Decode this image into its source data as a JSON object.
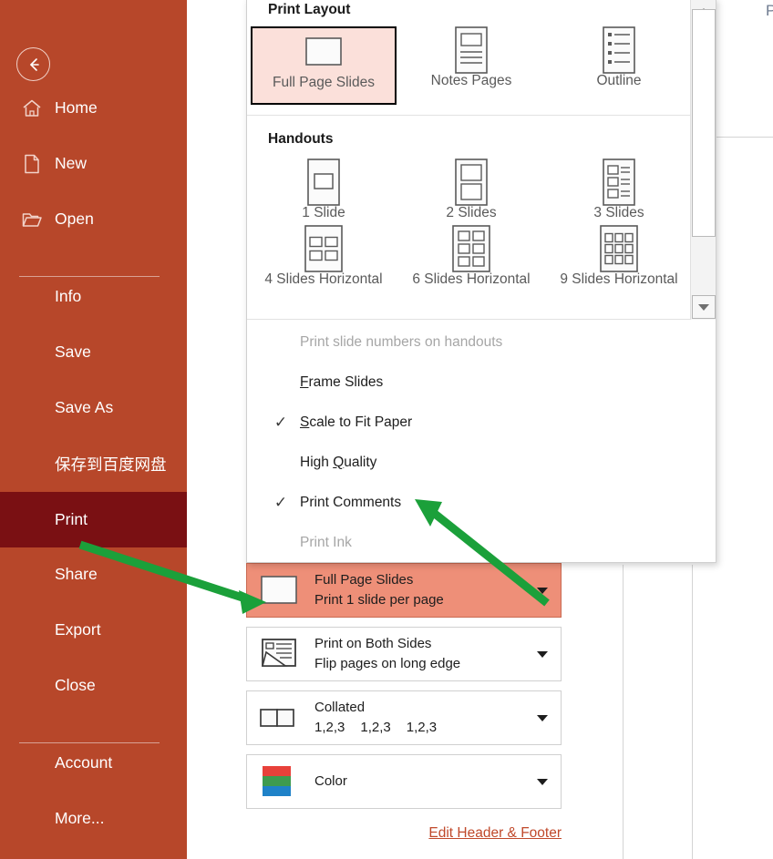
{
  "colors": {
    "nav_bg": "#b7472a",
    "nav_active_bg": "#7a1013",
    "selection_pink": "#fbe0da",
    "row_highlight": "#ee8f78",
    "link": "#c0492b",
    "annotation_arrow": "#1ba03a"
  },
  "sidebar": {
    "back_icon": "back-arrow-icon",
    "items": [
      {
        "label": "Home",
        "icon": "home-icon",
        "active": false,
        "indent": false
      },
      {
        "label": "New",
        "icon": "page-icon",
        "active": false,
        "indent": false
      },
      {
        "label": "Open",
        "icon": "folder-icon",
        "active": false,
        "indent": false
      },
      {
        "label": "Info",
        "icon": "",
        "active": false,
        "indent": true
      },
      {
        "label": "Save",
        "icon": "",
        "active": false,
        "indent": true
      },
      {
        "label": "Save As",
        "icon": "",
        "active": false,
        "indent": true
      },
      {
        "label": "保存到百度网盘",
        "icon": "",
        "active": false,
        "indent": true
      },
      {
        "label": "Print",
        "icon": "",
        "active": true,
        "indent": true
      },
      {
        "label": "Share",
        "icon": "",
        "active": false,
        "indent": true
      },
      {
        "label": "Export",
        "icon": "",
        "active": false,
        "indent": true
      },
      {
        "label": "Close",
        "icon": "",
        "active": false,
        "indent": true
      },
      {
        "label": "Account",
        "icon": "",
        "active": false,
        "indent": true
      },
      {
        "label": "More...",
        "icon": "",
        "active": false,
        "indent": true
      }
    ]
  },
  "background": {
    "partial_heading": "P"
  },
  "layout_dropdown": {
    "groups": [
      {
        "title": "Print Layout",
        "tiles": [
          {
            "label": "Full Page Slides",
            "icon": "full-page-slide-icon",
            "selected": true
          },
          {
            "label": "Notes Pages",
            "icon": "notes-page-icon",
            "selected": false
          },
          {
            "label": "Outline",
            "icon": "outline-icon",
            "selected": false
          }
        ]
      },
      {
        "title": "Handouts",
        "tiles": [
          {
            "label": "1 Slide",
            "icon": "handout-1-icon",
            "selected": false
          },
          {
            "label": "2 Slides",
            "icon": "handout-2-icon",
            "selected": false
          },
          {
            "label": "3 Slides",
            "icon": "handout-3-icon",
            "selected": false
          },
          {
            "label": "4 Slides Horizontal",
            "icon": "handout-4-icon",
            "selected": false
          },
          {
            "label": "6 Slides Horizontal",
            "icon": "handout-6-icon",
            "selected": false
          },
          {
            "label": "9 Slides Horizontal",
            "icon": "handout-9-icon",
            "selected": false
          }
        ]
      }
    ],
    "options": [
      {
        "label": "Print slide numbers on handouts",
        "checked": false,
        "disabled": true,
        "accel": ""
      },
      {
        "label": "Frame Slides",
        "checked": false,
        "disabled": false,
        "accel": "F"
      },
      {
        "label": "Scale to Fit Paper",
        "checked": true,
        "disabled": false,
        "accel": "S"
      },
      {
        "label": "High Quality",
        "checked": false,
        "disabled": false,
        "accel": "Q"
      },
      {
        "label": "Print Comments",
        "checked": true,
        "disabled": false,
        "accel": ""
      },
      {
        "label": "Print Ink",
        "checked": false,
        "disabled": true,
        "accel": ""
      }
    ],
    "check_glyph": "✓",
    "scrollbar": {
      "up_icon": "scroll-up-arrow-icon",
      "down_icon": "scroll-down-arrow-icon"
    }
  },
  "settings": {
    "rows": [
      {
        "icon": "full-page-slide-icon",
        "title": "Full Page Slides",
        "subtitle": "Print 1 slide per page",
        "highlighted": true,
        "caret": "chevron-down-icon"
      },
      {
        "icon": "both-sides-icon",
        "title": "Print on Both Sides",
        "subtitle": "Flip pages on long edge",
        "highlighted": false,
        "caret": "chevron-down-icon"
      },
      {
        "icon": "collated-icon",
        "title": "Collated",
        "subtitle": "",
        "collate_sequence": [
          "1,2,3",
          "1,2,3",
          "1,2,3"
        ],
        "highlighted": false,
        "caret": "chevron-down-icon"
      },
      {
        "icon": "color-icon",
        "title": "Color",
        "subtitle": "",
        "highlighted": false,
        "caret": "chevron-down-icon"
      }
    ],
    "footer_link": "Edit Header & Footer"
  }
}
